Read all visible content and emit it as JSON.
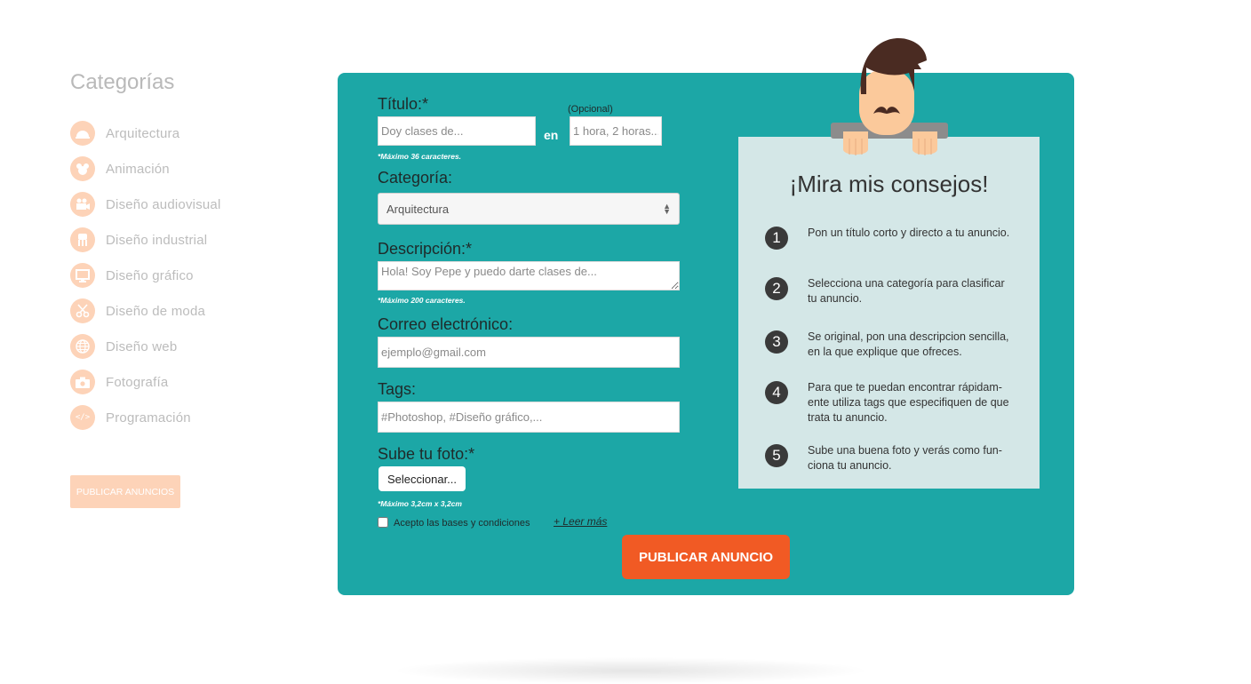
{
  "sidebar": {
    "title": "Categorías",
    "items": [
      {
        "label": "Arquitectura",
        "icon": "helmet-icon"
      },
      {
        "label": "Animación",
        "icon": "mouse-ears-icon"
      },
      {
        "label": "Diseño audiovisual",
        "icon": "video-camera-icon"
      },
      {
        "label": "Diseño industrial",
        "icon": "hand-icon"
      },
      {
        "label": "Diseño gráfico",
        "icon": "monitor-icon"
      },
      {
        "label": "Diseño de moda",
        "icon": "scissors-icon"
      },
      {
        "label": "Diseño web",
        "icon": "globe-icon"
      },
      {
        "label": "Fotografía",
        "icon": "camera-icon"
      },
      {
        "label": "Programación",
        "icon": "code-icon"
      }
    ],
    "button_label": "PUBLICAR ANUNCIOS"
  },
  "form": {
    "title_label": "Título:*",
    "title_placeholder": "Doy clases de...",
    "en_label": "en",
    "optional_label": "(Opcional)",
    "duration_placeholder": "1 hora, 2 horas...",
    "title_hint": "*Máximo 36 caracteres.",
    "category_label": "Categoría:",
    "category_value": "Arquitectura",
    "description_label": "Descripción:*",
    "description_placeholder": "Hola! Soy Pepe y puedo darte clases de...",
    "description_hint": "*Máximo 200 caracteres.",
    "email_label": "Correo electrónico:",
    "email_placeholder": "ejemplo@gmail.com",
    "tags_label": "Tags:",
    "tags_placeholder": "#Photoshop, #Diseño gráfico,...",
    "photo_label": "Sube tu foto:*",
    "file_button": "Seleccionar...",
    "photo_hint": "*Máximo 3,2cm x 3,2cm",
    "terms_label": "Acepto las bases y condiciones",
    "terms_checked": false,
    "read_more": "+ Leer más",
    "publish_button": "PUBLICAR ANUNCIO"
  },
  "tips": {
    "title": "¡Mira mis consejos!",
    "items": [
      {
        "num": "1",
        "text": "Pon un título corto y directo a tu anuncio."
      },
      {
        "num": "2",
        "text": "Selecciona una categoría para clasificar\ntu anuncio."
      },
      {
        "num": "3",
        "text": "Se original, pon una  descripcion sencilla,\nen la que explique que ofreces."
      },
      {
        "num": "4",
        "text": "Para que te puedan encontrar rápidam-\nente utiliza tags que especifiquen de que\ntrata tu anuncio."
      },
      {
        "num": "5",
        "text": "Sube una buena foto  y verás como fun-\nciona tu anuncio."
      }
    ]
  },
  "colors": {
    "panel": "#1ca7a6",
    "accent": "#f15a24",
    "sidebar_icon": "#fdd3b8",
    "tips_card": "#d4e7e7"
  }
}
